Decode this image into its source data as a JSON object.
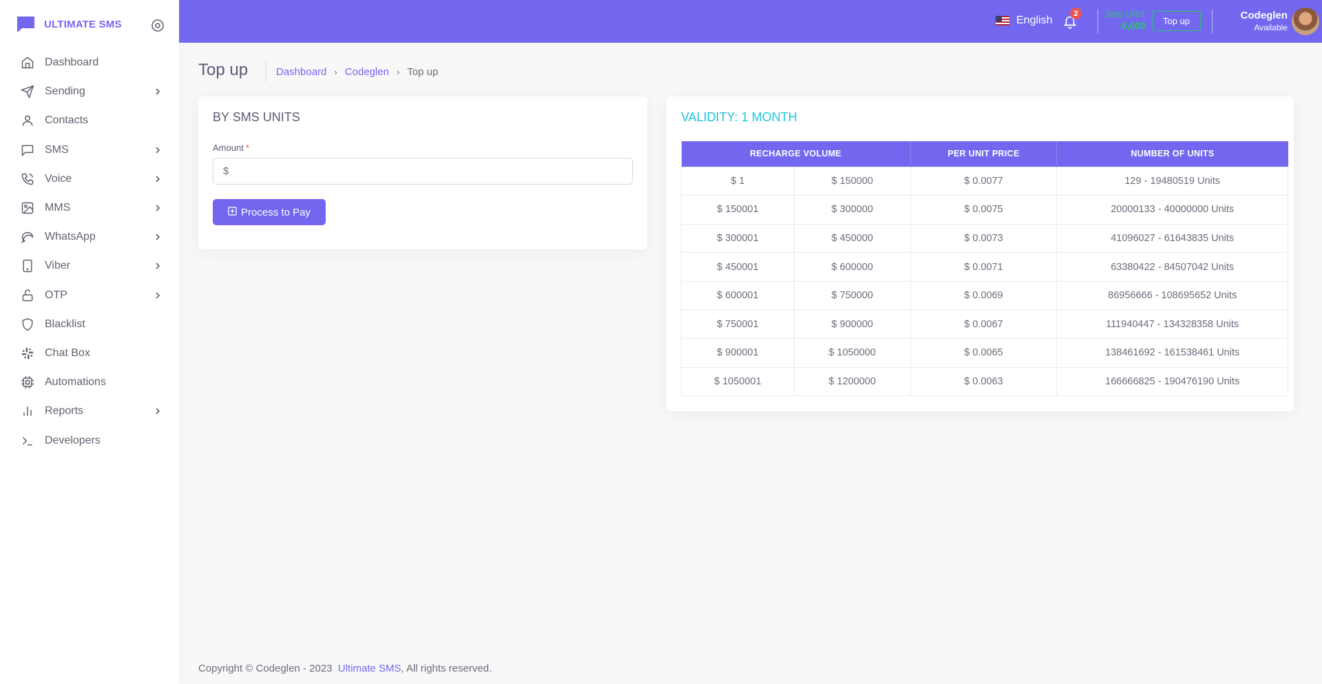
{
  "app": {
    "brand": "ULTIMATE SMS"
  },
  "sidebar": {
    "items": [
      {
        "label": "Dashboard",
        "icon": "home-icon",
        "has_children": false
      },
      {
        "label": "Sending",
        "icon": "send-icon",
        "has_children": true
      },
      {
        "label": "Contacts",
        "icon": "user-icon",
        "has_children": false
      },
      {
        "label": "SMS",
        "icon": "message-square-icon",
        "has_children": true
      },
      {
        "label": "Voice",
        "icon": "phone-call-icon",
        "has_children": true
      },
      {
        "label": "MMS",
        "icon": "image-icon",
        "has_children": true
      },
      {
        "label": "WhatsApp",
        "icon": "message-circle-icon",
        "has_children": true
      },
      {
        "label": "Viber",
        "icon": "tablet-icon",
        "has_children": true
      },
      {
        "label": "OTP",
        "icon": "unlock-icon",
        "has_children": true
      },
      {
        "label": "Blacklist",
        "icon": "shield-icon",
        "has_children": false
      },
      {
        "label": "Chat Box",
        "icon": "slack-icon",
        "has_children": false
      },
      {
        "label": "Automations",
        "icon": "cpu-icon",
        "has_children": false
      },
      {
        "label": "Reports",
        "icon": "bar-chart-icon",
        "has_children": true
      },
      {
        "label": "Developers",
        "icon": "terminal-icon",
        "has_children": false
      }
    ]
  },
  "header": {
    "language": "English",
    "notification_count": "2",
    "sms_unit_label": "SMS UNIT",
    "sms_unit_value": "6,000",
    "topup_label": "Top up",
    "user_name": "Codeglen",
    "user_status": "Available"
  },
  "page": {
    "title": "Top up",
    "breadcrumb": [
      "Dashboard",
      "Codeglen",
      "Top up"
    ]
  },
  "form_card": {
    "title": "BY SMS UNITS",
    "amount_label": "Amount",
    "amount_required": "*",
    "amount_placeholder": "$",
    "submit_label": "Process to Pay"
  },
  "pricing_card": {
    "title": "VALIDITY: 1 MONTH",
    "headers": [
      "RECHARGE VOLUME",
      "PER UNIT PRICE",
      "NUMBER OF UNITS"
    ],
    "rows": [
      [
        "$ 1",
        "$ 150000",
        "$ 0.0077",
        "129 - 19480519 Units"
      ],
      [
        "$ 150001",
        "$ 300000",
        "$ 0.0075",
        "20000133 - 40000000 Units"
      ],
      [
        "$ 300001",
        "$ 450000",
        "$ 0.0073",
        "41096027 - 61643835 Units"
      ],
      [
        "$ 450001",
        "$ 600000",
        "$ 0.0071",
        "63380422 - 84507042 Units"
      ],
      [
        "$ 600001",
        "$ 750000",
        "$ 0.0069",
        "86956666 - 108695652 Units"
      ],
      [
        "$ 750001",
        "$ 900000",
        "$ 0.0067",
        "111940447 - 134328358 Units"
      ],
      [
        "$ 900001",
        "$ 1050000",
        "$ 0.0065",
        "138461692 - 161538461 Units"
      ],
      [
        "$ 1050001",
        "$ 1200000",
        "$ 0.0063",
        "166666825 - 190476190 Units"
      ]
    ]
  },
  "footer": {
    "prefix": "Copyright © Codeglen - 2023",
    "link": "Ultimate SMS",
    "suffix": ", All rights reserved."
  },
  "colors": {
    "primary": "#7367f0",
    "success": "#28c76f",
    "info": "#21c4e0",
    "danger": "#ea5455"
  }
}
